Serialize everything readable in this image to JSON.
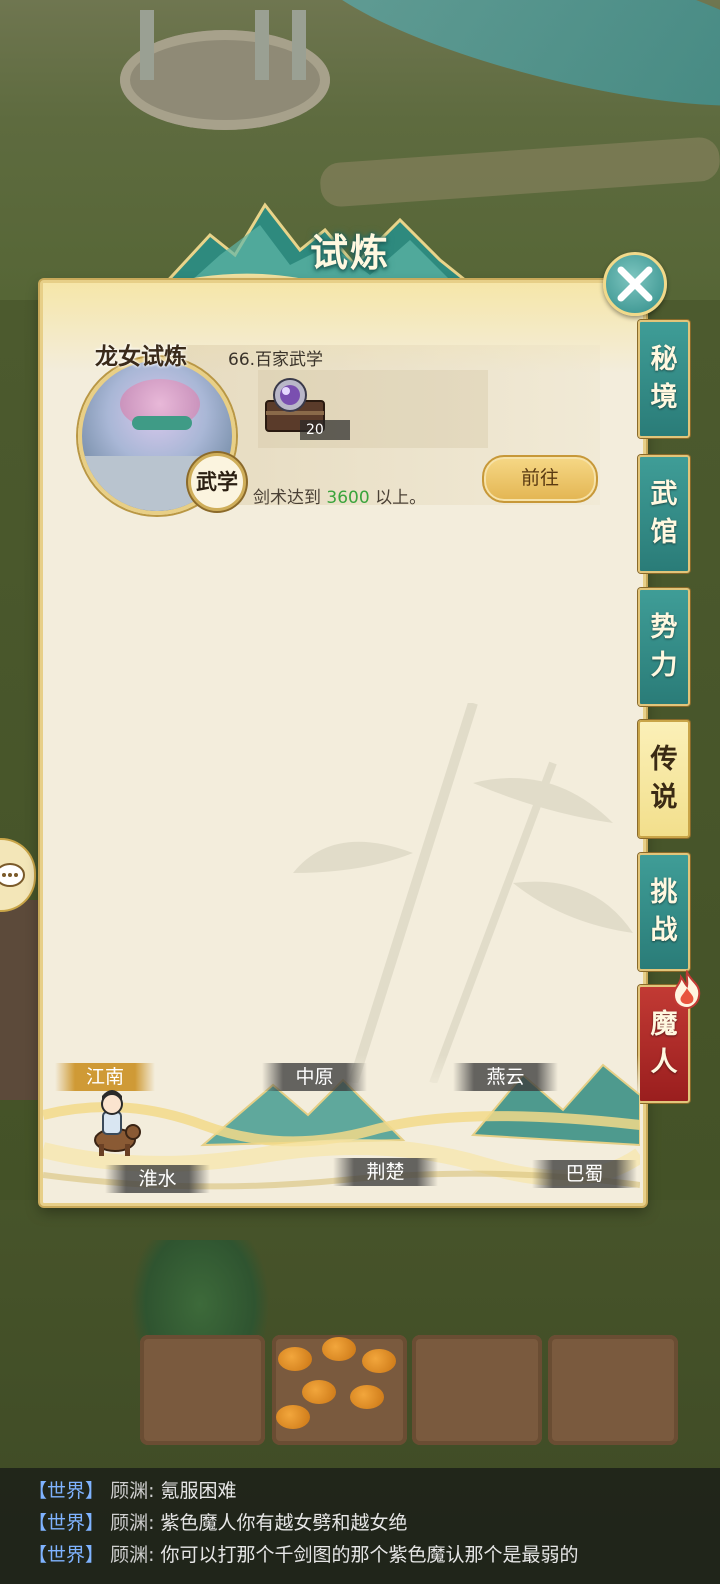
{
  "dialog": {
    "title": "试炼",
    "close_icon": "close-icon"
  },
  "side_tabs": [
    {
      "label_1": "秘",
      "label_2": "境",
      "state": "normal"
    },
    {
      "label_1": "武",
      "label_2": "馆",
      "state": "normal"
    },
    {
      "label_1": "势",
      "label_2": "力",
      "state": "normal"
    },
    {
      "label_1": "传",
      "label_2": "说",
      "state": "active"
    },
    {
      "label_1": "挑",
      "label_2": "战",
      "state": "normal"
    },
    {
      "label_1": "魔",
      "label_2": "人",
      "state": "red"
    }
  ],
  "trial": {
    "title": "龙女试炼",
    "subtitle": "66.百家武学",
    "badge": "武学",
    "reward_count": "20",
    "requirement_prefix": "剑术达到",
    "requirement_value": "3600",
    "requirement_suffix": "以上。",
    "go_button": "前往"
  },
  "regions": [
    {
      "name": "江南",
      "current": true
    },
    {
      "name": "中原",
      "current": false
    },
    {
      "name": "燕云",
      "current": false
    },
    {
      "name": "淮水",
      "current": false
    },
    {
      "name": "荆楚",
      "current": false
    },
    {
      "name": "巴蜀",
      "current": false
    }
  ],
  "chat": [
    {
      "channel": "【世界】",
      "name": "顾渊:",
      "text": "氪服困难"
    },
    {
      "channel": "【世界】",
      "name": "顾渊:",
      "text": "紫色魔人你有越女劈和越女绝"
    },
    {
      "channel": "【世界】",
      "name": "顾渊:",
      "text": "你可以打那个千剑图的那个紫色魔认那个是最弱的"
    }
  ],
  "colors": {
    "tab_teal": "#2f8c88",
    "tab_active": "#f2df8c",
    "tab_red": "#9a1e1e",
    "requirement_value": "#3aa43c",
    "chat_channel": "#7fb3ff"
  }
}
